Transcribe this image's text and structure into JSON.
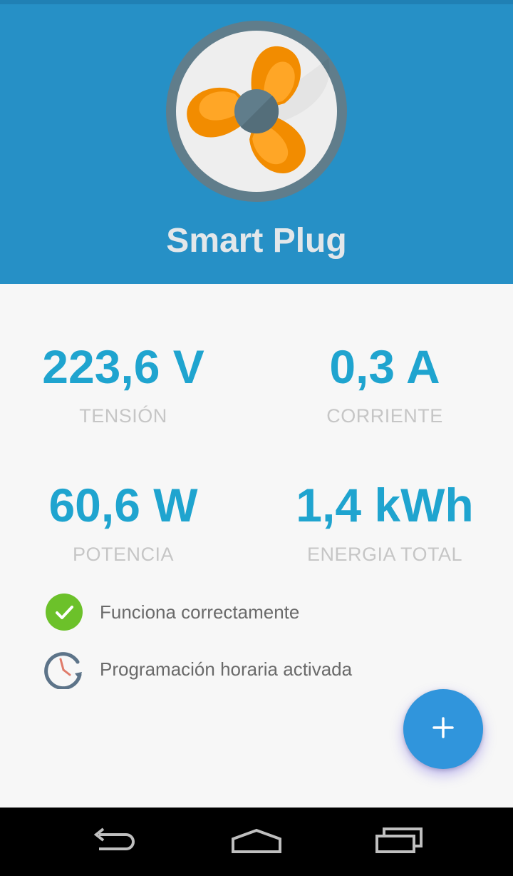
{
  "header": {
    "device_name": "Smart Plug",
    "device_icon": "fan-icon",
    "background_color": "#2690c6"
  },
  "metrics": {
    "voltage": {
      "value": "223,6 V",
      "label": "TENSIÓN"
    },
    "current": {
      "value": "0,3 A",
      "label": "CORRIENTE"
    },
    "power": {
      "value": "60,6 W",
      "label": "POTENCIA"
    },
    "energy": {
      "value": "1,4 kWh",
      "label": "ENERGIA TOTAL"
    }
  },
  "status": {
    "ok": {
      "text": "Funciona correctamente",
      "icon": "check-circle-icon"
    },
    "schedule": {
      "text": "Programación horaria activada",
      "icon": "clock-schedule-icon"
    }
  },
  "fab": {
    "icon": "plus-icon",
    "color": "#3095dc"
  },
  "navbar": {
    "back_icon": "back-icon",
    "home_icon": "home-icon",
    "recents_icon": "recents-icon"
  },
  "colors": {
    "accent": "#1fa4cf",
    "label": "#c6c6c6",
    "status_ok": "#6cc12a"
  }
}
